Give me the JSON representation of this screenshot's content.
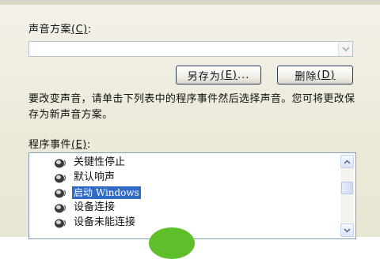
{
  "sound_scheme": {
    "label": "声音方案",
    "accelerator": "(C)",
    "label_suffix": ":",
    "value": ""
  },
  "buttons": {
    "save_as": {
      "label": "另存为",
      "accelerator": "(E)",
      "suffix": "..."
    },
    "delete": {
      "label": "删除",
      "accelerator": "(D)"
    }
  },
  "description": "要改变声音，请单击下列表中的程序事件然后选择声音。您可将更改保存为新声音方案。",
  "program_events": {
    "label": "程序事件",
    "accelerator": "(E)",
    "label_suffix": ":",
    "items": [
      {
        "label": "关键性停止",
        "selected": false
      },
      {
        "label": "默认响声",
        "selected": false
      },
      {
        "label": "启动 Windows",
        "selected": true
      },
      {
        "label": "设备连接",
        "selected": false
      },
      {
        "label": "设备未能连接",
        "selected": false
      }
    ],
    "item_icon": "speaker-icon"
  },
  "colors": {
    "selection": "#316ac5",
    "dialog_bg": "#ece9d8",
    "button_border": "#2a3a5a"
  }
}
